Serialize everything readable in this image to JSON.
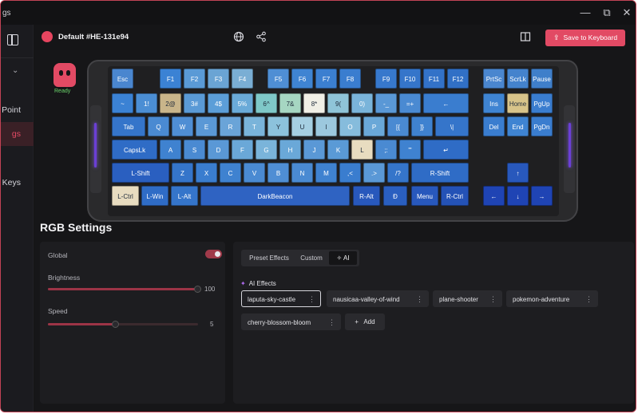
{
  "app": {
    "title_fragment": "gs"
  },
  "window_controls": {
    "minimize": "—",
    "maximize": "⧉",
    "close": "✕"
  },
  "sidebar": {
    "items": [
      "Point",
      "gs",
      "Keys"
    ],
    "active_index": 1
  },
  "header": {
    "profile_name": "Default #HE-131e94",
    "save_label": "Save to Keyboard"
  },
  "status": {
    "ready": "Ready"
  },
  "keyboard": {
    "colors": {
      "deep": "#1f44b4",
      "mid": "#2f63c2",
      "blue": "#3b82d4",
      "sky": "#5a9ad6",
      "light": "#7fb4dd",
      "pale": "#a6cfe2",
      "mint": "#8fd3c0",
      "cream": "#e8dcc0",
      "white": "#f1efe6",
      "tan": "#c9b58a",
      "gold": "#d8c48a",
      "navy": "#1a3a9a",
      "case": "#2a2a2c"
    },
    "keys": [
      {
        "id": "esc",
        "label": "Esc",
        "color": "#4a86cf"
      },
      {
        "id": "f1",
        "label": "F1",
        "color": "#3b82d4"
      },
      {
        "id": "f2",
        "label": "F2",
        "color": "#5a9ad6"
      },
      {
        "id": "f3",
        "label": "F3",
        "color": "#6aa4d4"
      },
      {
        "id": "f4",
        "label": "F4",
        "color": "#7aaed4"
      },
      {
        "id": "f5",
        "label": "F5",
        "color": "#4f8ed4"
      },
      {
        "id": "f6",
        "label": "F6",
        "color": "#3f84d2"
      },
      {
        "id": "f7",
        "label": "F7",
        "color": "#3b7fd0"
      },
      {
        "id": "f8",
        "label": "F8",
        "color": "#3a7dcf"
      },
      {
        "id": "f9",
        "label": "F9",
        "color": "#3778cc"
      },
      {
        "id": "f10",
        "label": "F10",
        "color": "#3575ca"
      },
      {
        "id": "f11",
        "label": "F11",
        "color": "#3372c8"
      },
      {
        "id": "f12",
        "label": "F12",
        "color": "#3170c6"
      },
      {
        "id": "prtsc",
        "label": "PrtSc",
        "color": "#4a86cf"
      },
      {
        "id": "scrlk",
        "label": "ScrLk",
        "color": "#4483cd"
      },
      {
        "id": "pause",
        "label": "Pause",
        "color": "#3f7fca"
      },
      {
        "id": "tilde",
        "label": "~",
        "color": "#3b82d4"
      },
      {
        "id": "1",
        "label": "1!",
        "color": "#4b8ed4"
      },
      {
        "id": "2",
        "label": "2@",
        "color": "#c9b58a"
      },
      {
        "id": "3",
        "label": "3#",
        "color": "#5a9ad6"
      },
      {
        "id": "4",
        "label": "4$",
        "color": "#5c9ed8"
      },
      {
        "id": "5",
        "label": "5%",
        "color": "#6aaad8"
      },
      {
        "id": "6",
        "label": "6^",
        "color": "#7fc8c8"
      },
      {
        "id": "7",
        "label": "7&",
        "color": "#a6d6c2"
      },
      {
        "id": "8",
        "label": "8*",
        "color": "#f1efe6"
      },
      {
        "id": "9",
        "label": "9(",
        "color": "#8fc4d8"
      },
      {
        "id": "0",
        "label": "0)",
        "color": "#7ab4da"
      },
      {
        "id": "minus",
        "label": "-_",
        "color": "#5a98d6"
      },
      {
        "id": "equal",
        "label": "=+",
        "color": "#4a8ad2"
      },
      {
        "id": "bksp",
        "label": "←",
        "color": "#3a7dcf"
      },
      {
        "id": "ins",
        "label": "Ins",
        "color": "#3f84d2"
      },
      {
        "id": "home",
        "label": "Home",
        "color": "#d8c48a"
      },
      {
        "id": "pgup",
        "label": "PgUp",
        "color": "#3a7dcf"
      },
      {
        "id": "tab",
        "label": "Tab",
        "color": "#3575ca"
      },
      {
        "id": "q",
        "label": "Q",
        "color": "#4a8ad2"
      },
      {
        "id": "w",
        "label": "W",
        "color": "#4f8ed4"
      },
      {
        "id": "e",
        "label": "E",
        "color": "#5a98d6"
      },
      {
        "id": "r",
        "label": "R",
        "color": "#6aa4d8"
      },
      {
        "id": "t",
        "label": "T",
        "color": "#7ab4da"
      },
      {
        "id": "y",
        "label": "Y",
        "color": "#8cc2dc"
      },
      {
        "id": "u",
        "label": "U",
        "color": "#a6cfe2"
      },
      {
        "id": "i",
        "label": "I",
        "color": "#9cc8de"
      },
      {
        "id": "o",
        "label": "O",
        "color": "#86bcdc"
      },
      {
        "id": "p",
        "label": "P",
        "color": "#6aa8d8"
      },
      {
        "id": "lbrack",
        "label": "[{",
        "color": "#4a8ad2"
      },
      {
        "id": "rbrack",
        "label": "]}",
        "color": "#3f82d0"
      },
      {
        "id": "bslash",
        "label": "\\|",
        "color": "#3575ca"
      },
      {
        "id": "del",
        "label": "Del",
        "color": "#3a7dcf"
      },
      {
        "id": "end",
        "label": "End",
        "color": "#3f84d2"
      },
      {
        "id": "pgdn",
        "label": "PgDn",
        "color": "#3a7dcf"
      },
      {
        "id": "caps",
        "label": "CapsLk",
        "color": "#2f6cc6"
      },
      {
        "id": "a",
        "label": "A",
        "color": "#3f82d0"
      },
      {
        "id": "s",
        "label": "S",
        "color": "#4a8ad2"
      },
      {
        "id": "d",
        "label": "D",
        "color": "#5a98d6"
      },
      {
        "id": "f",
        "label": "F",
        "color": "#6aa8d8"
      },
      {
        "id": "g",
        "label": "G",
        "color": "#7ab4da"
      },
      {
        "id": "h",
        "label": "H",
        "color": "#6aa8d8"
      },
      {
        "id": "j",
        "label": "J",
        "color": "#5a98d6"
      },
      {
        "id": "k",
        "label": "K",
        "color": "#5a9ad6"
      },
      {
        "id": "l",
        "label": "L",
        "color": "#e8dcc0"
      },
      {
        "id": "semi",
        "label": ";:",
        "color": "#4a8ad2"
      },
      {
        "id": "quote",
        "label": "\"'",
        "color": "#3f82d0"
      },
      {
        "id": "enter",
        "label": "↵",
        "color": "#2f6cc6"
      },
      {
        "id": "lshift",
        "label": "L-Shift",
        "color": "#2a5fc0"
      },
      {
        "id": "z",
        "label": "Z",
        "color": "#3575ca"
      },
      {
        "id": "x",
        "label": "X",
        "color": "#3a7dcf"
      },
      {
        "id": "c",
        "label": "C",
        "color": "#3f82d0"
      },
      {
        "id": "v",
        "label": "V",
        "color": "#4a8ad2"
      },
      {
        "id": "b",
        "label": "B",
        "color": "#4f8ed4"
      },
      {
        "id": "n",
        "label": "N",
        "color": "#4a8ad2"
      },
      {
        "id": "m",
        "label": "M",
        "color": "#3f82d0"
      },
      {
        "id": "comma",
        "label": ",<",
        "color": "#3a7dcf"
      },
      {
        "id": "period",
        "label": ".>",
        "color": "#5a98d6"
      },
      {
        "id": "slash",
        "label": "/?",
        "color": "#3575ca"
      },
      {
        "id": "rshift",
        "label": "R-Shift",
        "color": "#2f6cc6"
      },
      {
        "id": "up",
        "label": "↑",
        "color": "#2858bc"
      },
      {
        "id": "lctrl",
        "label": "L-Ctrl",
        "color": "#e8dcc0"
      },
      {
        "id": "lwin",
        "label": "L-Win",
        "color": "#2f6cc6"
      },
      {
        "id": "lalt",
        "label": "L-Alt",
        "color": "#3575ca"
      },
      {
        "id": "space",
        "label": "DarkBeacon",
        "color": "#2f63c2"
      },
      {
        "id": "ralt",
        "label": "R-Alt",
        "color": "#2858bc"
      },
      {
        "id": "fn",
        "label": "Ð",
        "color": "#2a5fc0"
      },
      {
        "id": "menu",
        "label": "Menu",
        "color": "#2858bc"
      },
      {
        "id": "rctrl",
        "label": "R-Ctrl",
        "color": "#2452b6"
      },
      {
        "id": "left",
        "label": "←",
        "color": "#1f44b4"
      },
      {
        "id": "down",
        "label": "↓",
        "color": "#1f44b4"
      },
      {
        "id": "right",
        "label": "→",
        "color": "#1f44b4"
      }
    ]
  },
  "rgb": {
    "title": "RGB Settings",
    "global_label": "Global",
    "global_on": true,
    "brightness_label": "Brightness",
    "brightness_value": "100",
    "brightness_level": 1.0,
    "speed_label": "Speed",
    "speed_value": "5",
    "speed_level": 0.45
  },
  "effects": {
    "tabs": [
      "Preset Effects",
      "Custom",
      "AI"
    ],
    "active_tab": 2,
    "ai_header": "AI Effects",
    "chips": [
      "laputa-sky-castle",
      "nausicaa-valley-of-wind",
      "plane-shooter",
      "pokemon-adventure",
      "cherry-blossom-bloom"
    ],
    "selected_chip": 0,
    "add_label": "Add"
  }
}
